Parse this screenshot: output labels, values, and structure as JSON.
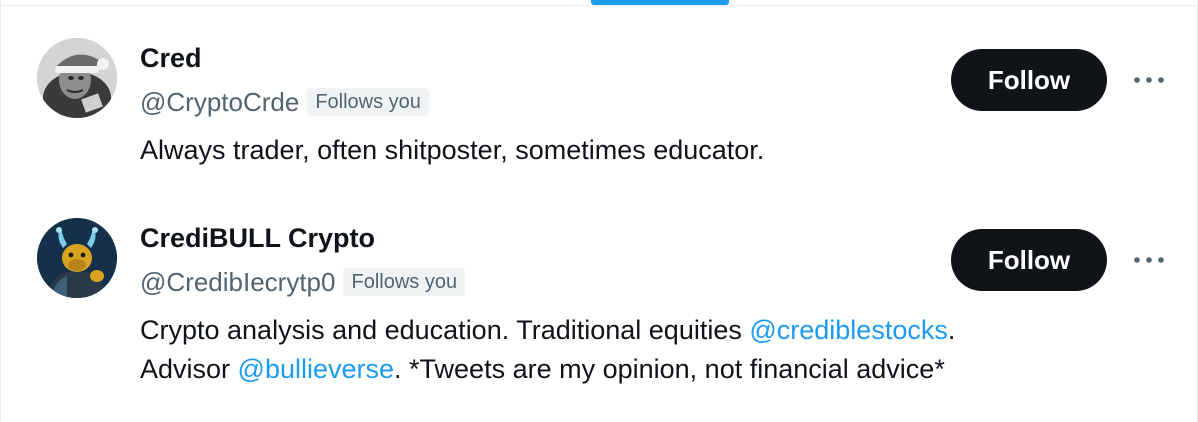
{
  "users": [
    {
      "name": "Cred",
      "handle": "@CryptoCrde",
      "follows_you": "Follows you",
      "bio_parts": [
        "Always trader, often shitposter, sometimes educator."
      ],
      "follow_label": "Follow",
      "avatar_icon": "santa-hat-portrait-avatar"
    },
    {
      "name": "CrediBULL Crypto",
      "handle": "@CredibIecrytp0",
      "follows_you": "Follows you",
      "bio": {
        "line1_text": "Crypto analysis and education. Traditional equities ",
        "line1_mention": "@crediblestocks",
        "line1_end": ".",
        "line2_text": "Advisor ",
        "line2_mention": "@bullieverse",
        "line2_end": ". *Tweets are my opinion, not financial advice*"
      },
      "follow_label": "Follow",
      "avatar_icon": "golden-bull-avatar"
    }
  ],
  "colors": {
    "accent": "#1d9bf0",
    "button_bg": "#0f1419",
    "secondary_text": "#536471",
    "badge_bg": "#eff3f4"
  },
  "icons": {
    "more": "more-options-icon"
  }
}
